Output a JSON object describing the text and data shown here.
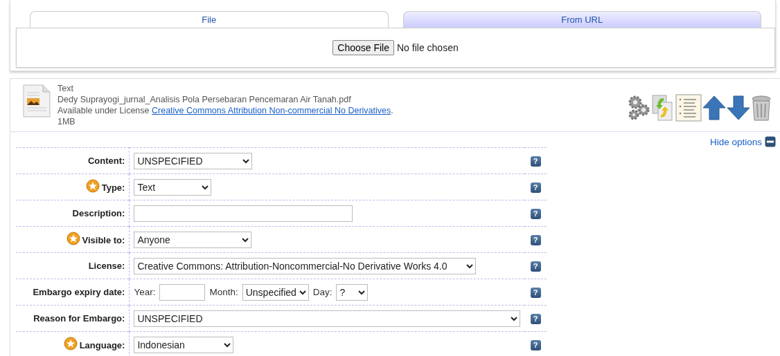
{
  "upload_tabs": [
    {
      "label": "File",
      "selected": true
    },
    {
      "label": "From URL",
      "selected": false
    }
  ],
  "file_input": {
    "button": "Choose File",
    "status": "No file chosen"
  },
  "document": {
    "type": "Text",
    "filename": "Dedy Suprayogi_jurnal_Analisis Pola Persebaran Pencemaran Air Tanah.pdf",
    "license_prefix": "Available under License ",
    "license_link": "Creative Commons Attribution Non-commercial No Derivatives",
    "license_suffix": ".",
    "size": "1MB"
  },
  "hide_options": "Hide options",
  "fields": [
    {
      "kind": "select",
      "label": "Content:",
      "required": false,
      "value": "UNSPECIFIED",
      "help": "?"
    },
    {
      "kind": "select",
      "label": "Type:",
      "required": true,
      "value": "Text",
      "help": "?"
    },
    {
      "kind": "text",
      "label": "Description:",
      "required": false,
      "help": "?"
    },
    {
      "kind": "select",
      "label": "Visible to:",
      "required": true,
      "value": "Anyone",
      "help": "?"
    },
    {
      "kind": "select",
      "label": "License:",
      "required": false,
      "value": "Creative Commons: Attribution-Noncommercial-No Derivative Works 4.0",
      "help": "?"
    },
    {
      "kind": "date",
      "label": "Embargo expiry date:",
      "required": false,
      "year_label": "Year:",
      "month_label": "Month:",
      "month": "Unspecified",
      "day_label": "Day:",
      "day": "?",
      "help": "?"
    },
    {
      "kind": "select",
      "label": "Reason for Embargo:",
      "required": false,
      "value": "UNSPECIFIED",
      "help": "?"
    },
    {
      "kind": "select",
      "label": "Language:",
      "required": true,
      "value": "Indonesian",
      "help": "?"
    }
  ]
}
